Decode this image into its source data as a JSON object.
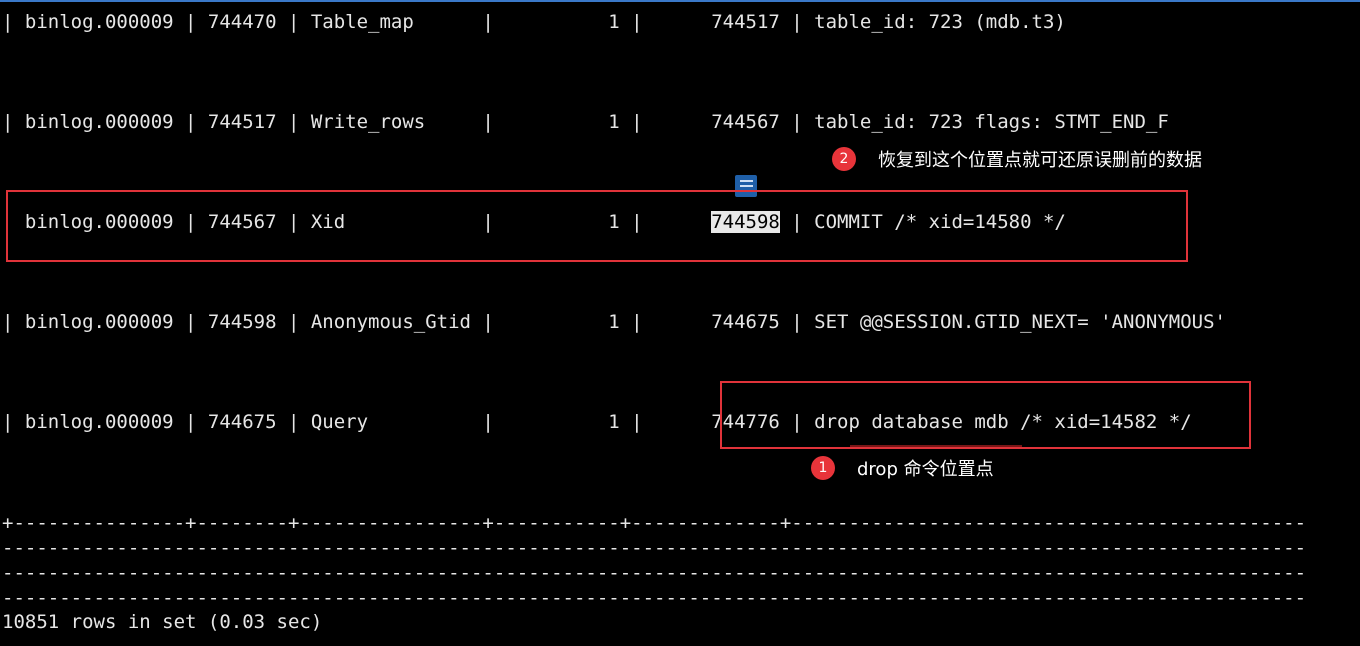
{
  "terminal": {
    "rows": [
      {
        "pre": "| binlog.000009 | 744470 | Table_map      |          1 |      ",
        "end_pos": "744517",
        "post": " | table_id: 723 (mdb.t3)"
      },
      {
        "pre": "| binlog.000009 | 744517 | Write_rows     |          1 |      ",
        "end_pos": "744567",
        "post": " | table_id: 723 flags: STMT_END_F"
      },
      {
        "pre": "  binlog.000009 | 744567 | Xid            |          1 |      ",
        "end_pos": "744598",
        "post": " | COMMIT /* xid=14580 */"
      },
      {
        "pre": "| binlog.000009 | 744598 | Anonymous_Gtid |          1 |      ",
        "end_pos": "744675",
        "post": " | SET @@SESSION.GTID_NEXT= 'ANONYMOUS'"
      },
      {
        "pre": "| binlog.000009 | 744675 | Query          |          1 |      ",
        "end_pos": "744776",
        "post": " | drop database mdb /* xid=14582 */"
      }
    ],
    "separator": "+---------------+--------+----------------+-----------+-------------+---------------------------------------------",
    "dashes": "------------------------------------------------------------------------------------------------------------------",
    "footer": "10851 rows in set (0.03 sec)"
  },
  "annotations": [
    {
      "number": "2",
      "text": "恢复到这个位置点就可还原误删前的数据"
    },
    {
      "number": "1",
      "text": "drop 命令位置点"
    }
  ],
  "colors": {
    "background": "#000000",
    "text": "#e6e6e6",
    "highlight_box": "#e0333a",
    "badge": "#e8343a",
    "selection": "#e8e8e8"
  }
}
